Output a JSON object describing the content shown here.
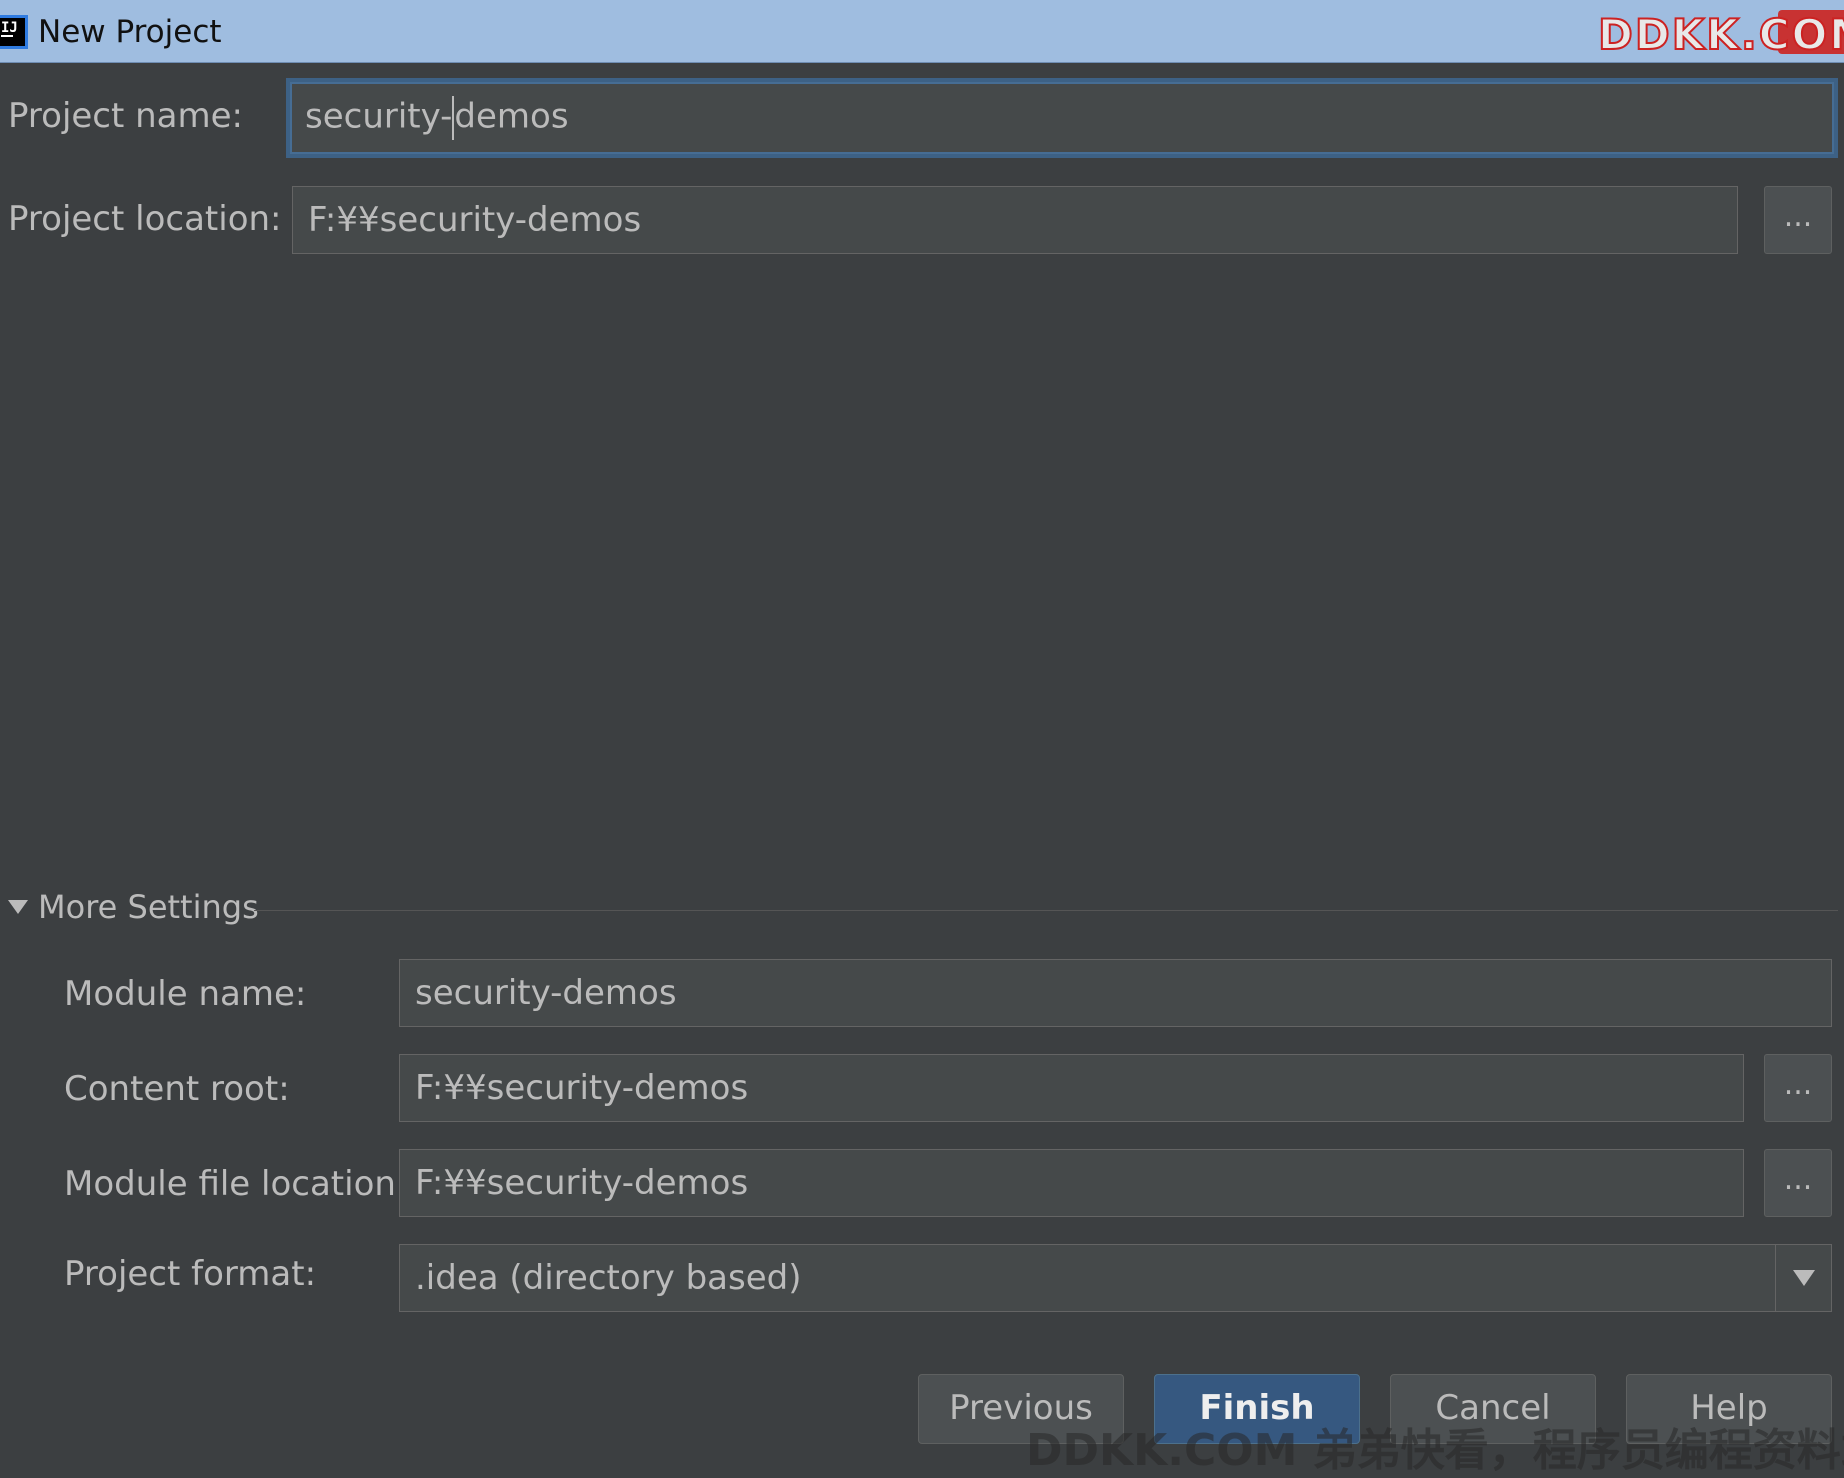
{
  "window": {
    "title": "New Project",
    "watermark": "DDKK.COM"
  },
  "form": {
    "project_name_label": "Project name:",
    "project_name_value": "security-demos",
    "project_location_label": "Project location:",
    "project_location_value": "F:¥¥security-demos",
    "browse_label": "..."
  },
  "more_settings": {
    "label": "More Settings",
    "expanded": true,
    "module_name_label": "Module name:",
    "module_name_value": "security-demos",
    "content_root_label": "Content root:",
    "content_root_value": "F:¥¥security-demos",
    "module_file_location_label": "Module file location:",
    "module_file_location_value": "F:¥¥security-demos",
    "project_format_label": "Project format:",
    "project_format_value": ".idea (directory based)"
  },
  "buttons": {
    "previous": "Previous",
    "finish": "Finish",
    "cancel": "Cancel",
    "help": "Help"
  },
  "footer_watermark": "DDKK.COM 弟弟快看，程序员编程资料站",
  "colors": {
    "background": "#3c3f41",
    "field": "#45494a",
    "primary_button": "#365880",
    "titlebar": "#9fbde0",
    "focus_border": "#3d6185"
  },
  "icons": [
    "intellij-app-icon",
    "triangle-down-icon",
    "dropdown-arrow-icon"
  ]
}
